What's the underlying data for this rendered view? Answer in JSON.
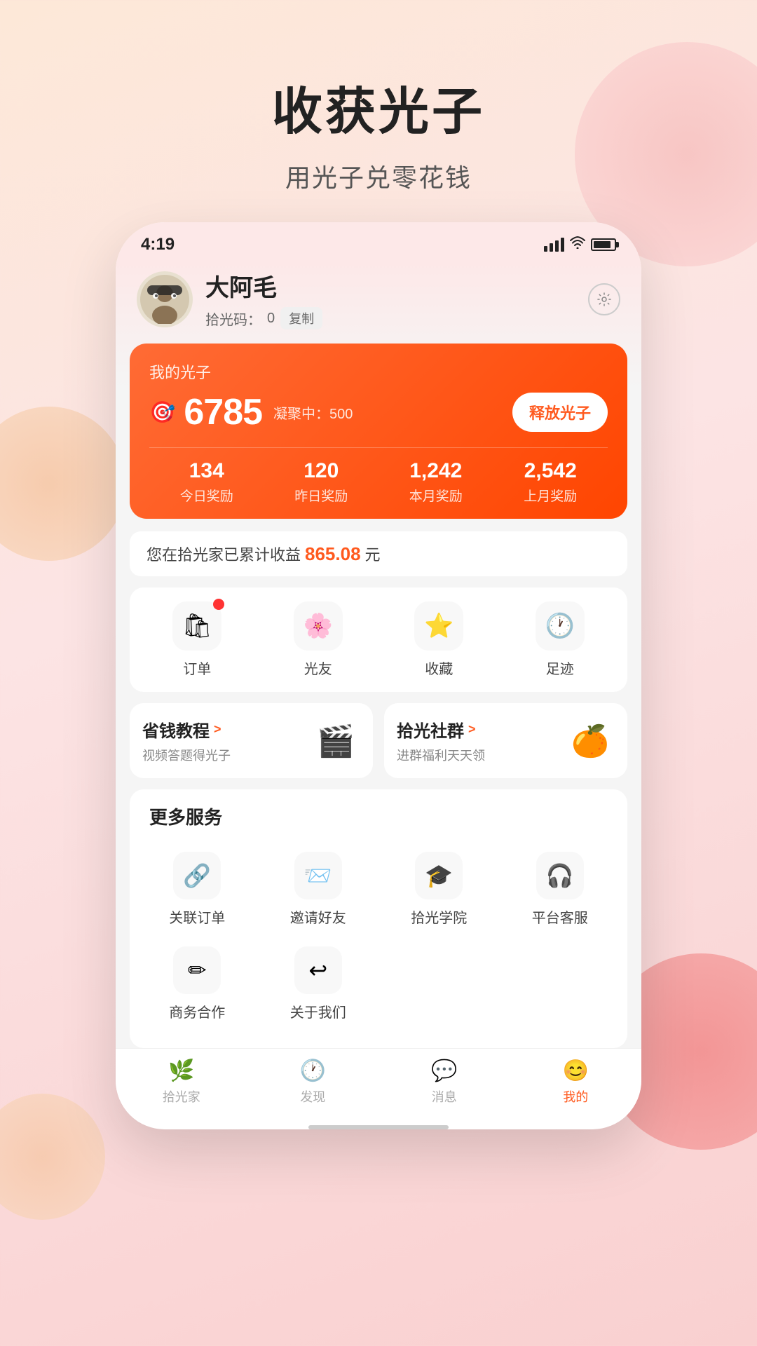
{
  "page": {
    "main_title": "收获光子",
    "subtitle": "用光子兑零花钱"
  },
  "status_bar": {
    "time": "4:19"
  },
  "user": {
    "name": "大阿毛",
    "pickup_code_label": "拾光码：",
    "pickup_code_value": "0",
    "copy_label": "复制"
  },
  "guangzi_card": {
    "title": "我的光子",
    "points": "6785",
    "pending_label": "凝聚中：500",
    "release_btn": "释放光子",
    "stats": [
      {
        "number": "134",
        "label": "今日奖励"
      },
      {
        "number": "120",
        "label": "昨日奖励"
      },
      {
        "number": "1,242",
        "label": "本月奖励"
      },
      {
        "number": "2,542",
        "label": "上月奖励"
      }
    ]
  },
  "earnings": {
    "prefix": "您在拾光家已累计收益",
    "amount": "865.08",
    "suffix": "元"
  },
  "quick_actions": [
    {
      "id": "orders",
      "icon": "🛍",
      "label": "订单",
      "badge": true
    },
    {
      "id": "friends",
      "icon": "🌸",
      "label": "光友",
      "badge": false
    },
    {
      "id": "favorites",
      "icon": "⭐",
      "label": "收藏",
      "badge": false
    },
    {
      "id": "history",
      "icon": "🕐",
      "label": "足迹",
      "badge": false
    }
  ],
  "promo_cards": [
    {
      "id": "tutorial",
      "title": "省钱教程",
      "subtitle": "视频答题得光子",
      "icon": "🎬",
      "arrow": ">"
    },
    {
      "id": "community",
      "title": "拾光社群",
      "subtitle": "进群福利天天领",
      "icon": "🍊",
      "arrow": ">"
    }
  ],
  "more_services": {
    "title": "更多服务",
    "items": [
      {
        "id": "linked-orders",
        "icon": "🔗",
        "label": "关联订单"
      },
      {
        "id": "invite-friends",
        "icon": "📨",
        "label": "邀请好友"
      },
      {
        "id": "academy",
        "icon": "🎓",
        "label": "拾光学院"
      },
      {
        "id": "customer-service",
        "icon": "🎧",
        "label": "平台客服"
      },
      {
        "id": "biz-coop",
        "icon": "✏",
        "label": "商务合作"
      },
      {
        "id": "about-us",
        "icon": "↩",
        "label": "关于我们"
      }
    ]
  },
  "bottom_nav": [
    {
      "id": "home",
      "icon": "🌿",
      "label": "拾光家",
      "active": false
    },
    {
      "id": "discover",
      "icon": "🕐",
      "label": "发现",
      "active": false
    },
    {
      "id": "messages",
      "icon": "💬",
      "label": "消息",
      "active": false
    },
    {
      "id": "mine",
      "icon": "😊",
      "label": "我的",
      "active": true
    }
  ]
}
